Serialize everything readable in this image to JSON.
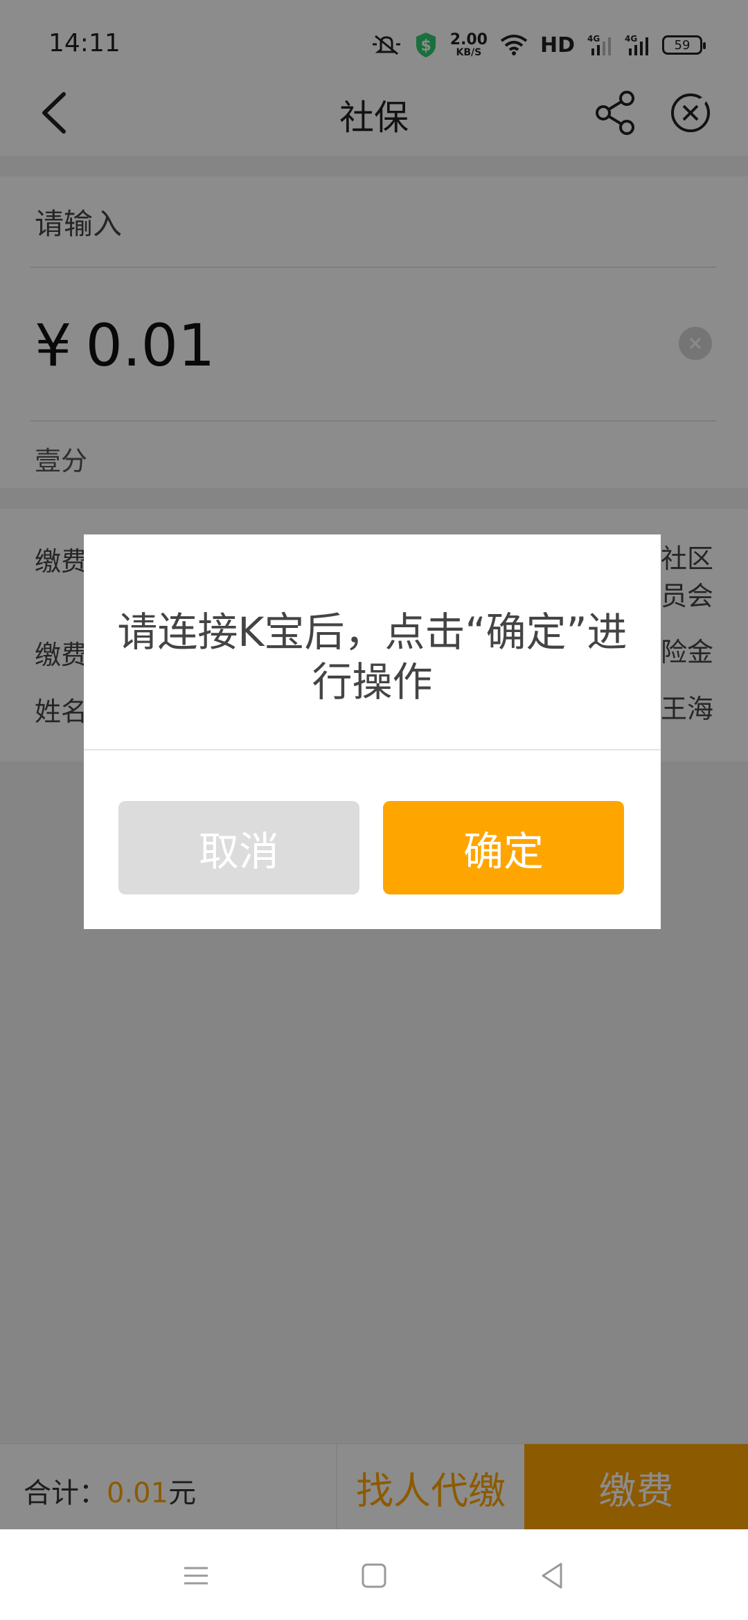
{
  "status_bar": {
    "time": "14:11",
    "net_speed_value": "2.00",
    "net_speed_unit": "KB/S",
    "hd_label": "HD",
    "sim1_label": "4G",
    "sim2_label": "4G",
    "battery": "59"
  },
  "header": {
    "title": "社保"
  },
  "amount": {
    "input_label": "请输入",
    "currency": "¥",
    "value": "0.01",
    "words": "壹分"
  },
  "info": {
    "rows": [
      {
        "key": "缴费",
        "value": "社区\n员会"
      },
      {
        "key": "缴费",
        "value": "险金"
      },
      {
        "key": "姓名",
        "value": "王海"
      }
    ]
  },
  "bottom": {
    "total_label": "合计：",
    "total_amount": "0.01",
    "total_unit": "元",
    "find_agent_label": "找人代缴",
    "pay_label": "缴费"
  },
  "dialog": {
    "message": "请连接K宝后，点击“确定”进行操作",
    "cancel_label": "取消",
    "confirm_label": "确定"
  },
  "colors": {
    "accent": "#FFA500",
    "overlay": "rgba(0,0,0,0.45)"
  },
  "icons": {
    "back": "chevron-left-icon",
    "share": "share-icon",
    "close": "close-circle-icon",
    "clear": "clear-icon",
    "nav_menu": "menu-icon",
    "nav_home": "home-icon",
    "nav_back": "triangle-back-icon"
  }
}
